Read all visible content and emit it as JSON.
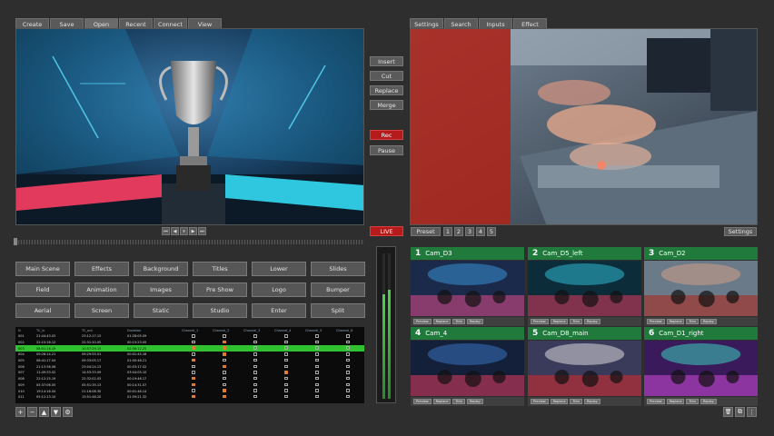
{
  "top_tabs": [
    "Create",
    "Save",
    "Open",
    "Recent",
    "Connect",
    "View"
  ],
  "program_tabs": [
    "Settings",
    "Search",
    "Inputs",
    "Effect"
  ],
  "edit_buttons": [
    "Insert",
    "Cut",
    "Replace",
    "Merge"
  ],
  "rec_label": "Rec",
  "pause_label": "Pause",
  "live_label": "LIVE",
  "preset_label": "Preset",
  "preset_numbers": [
    "1",
    "2",
    "3",
    "4",
    "5"
  ],
  "settings_label": "Settings",
  "transport": [
    "⏮",
    "◀",
    "⏸",
    "▶",
    "⏭"
  ],
  "scene_buttons": [
    "Main Scene",
    "Effects",
    "Background",
    "Titles",
    "Lower",
    "Slides",
    "Field",
    "Animation",
    "Images",
    "Pre Show",
    "Logo",
    "Bumper",
    "Aerial",
    "Screen",
    "Static",
    "Studio",
    "Enter",
    "Split"
  ],
  "table": {
    "headers": [
      "N",
      "TC_in",
      "TC_out",
      "Duration",
      "Channel_1",
      "Channel_2",
      "Channel_3",
      "Channel_4",
      "Channel_5",
      "Channel_6"
    ],
    "rows": [
      [
        "001",
        "21:44:43.03",
        "23:12:17.13",
        "01:28:05.09"
      ],
      [
        "002",
        "22:15:16.12",
        "22:31:20.05",
        "00:15:23.05"
      ],
      [
        "003",
        "08:01:18.19",
        "10:57:29.15",
        "02:56:12.25"
      ],
      [
        "004",
        "09:26:14.21",
        "09:29:55.01",
        "00:01:45.18"
      ],
      [
        "005",
        "08:41:17.04",
        "09:33:05.17",
        "01:00:46.21"
      ],
      [
        "006",
        "21:13:36.06",
        "23:04:24.13",
        "00:53:17.02"
      ],
      [
        "007",
        "11:49:33.02",
        "14:53:33.09",
        "03:04:05.10"
      ],
      [
        "008",
        "22:12:15.19",
        "22:32:02.03",
        "00:19:46.17"
      ],
      [
        "009",
        "05:37:06.05",
        "05:51:35.13",
        "00:14:31.07"
      ],
      [
        "010",
        "19:14:16.04",
        "21:16:08.30",
        "00:01:48.14"
      ],
      [
        "011",
        "05:12:13.10",
        "13:51:48.20",
        "01:59:21.32"
      ]
    ],
    "highlight_row": 2,
    "orange_marks": [
      [
        1,
        1
      ],
      [
        2,
        0
      ],
      [
        2,
        1
      ],
      [
        3,
        1
      ],
      [
        4,
        0
      ],
      [
        5,
        1
      ],
      [
        7,
        0
      ],
      [
        8,
        0
      ],
      [
        9,
        1
      ],
      [
        10,
        0
      ],
      [
        10,
        1
      ],
      [
        6,
        3
      ]
    ]
  },
  "cameras": [
    {
      "num": "1",
      "name": "Cam_D3"
    },
    {
      "num": "2",
      "name": "Cam_D5_left"
    },
    {
      "num": "3",
      "name": "Cam_D2"
    },
    {
      "num": "4",
      "name": "Cam_4"
    },
    {
      "num": "5",
      "name": "Cam_D8_main"
    },
    {
      "num": "6",
      "name": "Cam_D1_right"
    }
  ],
  "cam_buttons": [
    "Preview",
    "Replace",
    "Trim",
    "Replay"
  ],
  "bottom_icons": [
    "+",
    "−",
    "▲",
    "▼",
    "⚙"
  ],
  "right_icons": [
    "🗑",
    "⧉",
    "⋮"
  ],
  "audio_levels": [
    0.72,
    0.75
  ]
}
